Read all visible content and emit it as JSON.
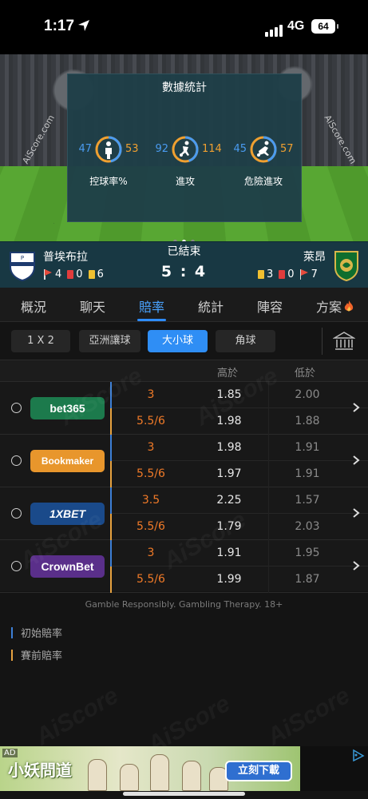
{
  "status_bar": {
    "time": "1:17",
    "network": "4G",
    "battery": "64"
  },
  "hero": {
    "watermark": "AiScore.com",
    "panel_title": "數據統計",
    "stats": [
      {
        "label": "控球率%",
        "home": "47",
        "away": "53",
        "home_share": 0.47
      },
      {
        "label": "進攻",
        "home": "92",
        "away": "114",
        "home_share": 0.45
      },
      {
        "label": "危險進攻",
        "home": "45",
        "away": "57",
        "home_share": 0.44
      }
    ],
    "page_dots": 3,
    "active_dot": 1
  },
  "match": {
    "status": "已結束",
    "score": "5 : 4",
    "home": {
      "name": "普埃布拉",
      "corners": "4",
      "red_cards": "0",
      "yellow_cards": "6"
    },
    "away": {
      "name": "萊昂",
      "yellow_cards": "3",
      "red_cards": "0",
      "corners": "7"
    }
  },
  "tabs": [
    {
      "label": "概況"
    },
    {
      "label": "聊天"
    },
    {
      "label": "賠率",
      "active": true
    },
    {
      "label": "統計"
    },
    {
      "label": "陣容"
    },
    {
      "label": "方案"
    }
  ],
  "sub_tabs": [
    {
      "label": "1 X 2"
    },
    {
      "label": "亞洲讓球"
    },
    {
      "label": "大小球",
      "active": true
    },
    {
      "label": "角球"
    }
  ],
  "odds_table": {
    "headers": {
      "over": "高於",
      "under": "低於"
    },
    "bookmakers": [
      {
        "name": "bet365",
        "color": "#1c7a4c",
        "initial": {
          "line": "3",
          "over": "1.85",
          "under": "2.00"
        },
        "pre": {
          "line": "5.5/6",
          "over": "1.98",
          "under": "1.88"
        }
      },
      {
        "name": "Bookmaker",
        "color": "#e8962c",
        "initial": {
          "line": "3",
          "over": "1.98",
          "under": "1.91"
        },
        "pre": {
          "line": "5.5/6",
          "over": "1.97",
          "under": "1.91"
        }
      },
      {
        "name": "1XBET",
        "color": "#1a4a8a",
        "initial": {
          "line": "3.5",
          "over": "2.25",
          "under": "1.57"
        },
        "pre": {
          "line": "5.5/6",
          "over": "1.79",
          "under": "2.03"
        }
      },
      {
        "name": "CrownBet",
        "color": "#5a2f8a",
        "initial": {
          "line": "3",
          "over": "1.91",
          "under": "1.95"
        },
        "pre": {
          "line": "5.5/6",
          "over": "1.99",
          "under": "1.87"
        }
      }
    ]
  },
  "disclaimer": "Gamble Responsibly. Gambling Therapy. 18+",
  "legend": [
    {
      "label": "初始賠率",
      "color": "#3d7fd6"
    },
    {
      "label": "賽前賠率",
      "color": "#e7a240"
    }
  ],
  "watermark": "AiScore",
  "ad": {
    "badge": "AD",
    "brand": "小妖問道",
    "cta": "立刻下載"
  },
  "colors": {
    "accent": "#2f8ef5",
    "home_stat": "#4a9bf0",
    "away_stat": "#f0a030",
    "line_value": "#f07a28"
  }
}
